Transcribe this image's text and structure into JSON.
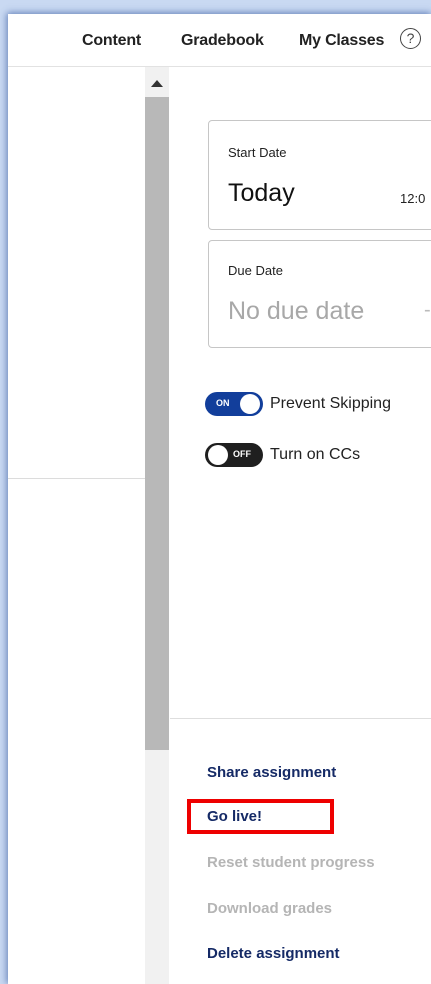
{
  "nav": {
    "items": [
      "Content",
      "Gradebook",
      "My Classes"
    ],
    "help_icon": "?"
  },
  "start_date": {
    "label": "Start Date",
    "value": "Today",
    "time": "12:0"
  },
  "due_date": {
    "label": "Due Date",
    "placeholder": "No due date",
    "dash": "-"
  },
  "toggles": [
    {
      "state": "on",
      "state_label": "ON",
      "label": "Prevent Skipping"
    },
    {
      "state": "off",
      "state_label": "OFF",
      "label": "Turn on CCs"
    }
  ],
  "actions": {
    "share": "Share assignment",
    "go_live": "Go live!",
    "reset": "Reset student progress",
    "download": "Download grades",
    "delete": "Delete assignment"
  },
  "colors": {
    "accent": "#123e9b",
    "action_text": "#152a66",
    "disabled_text": "#b5b5b5",
    "highlight": "#ee0000"
  }
}
